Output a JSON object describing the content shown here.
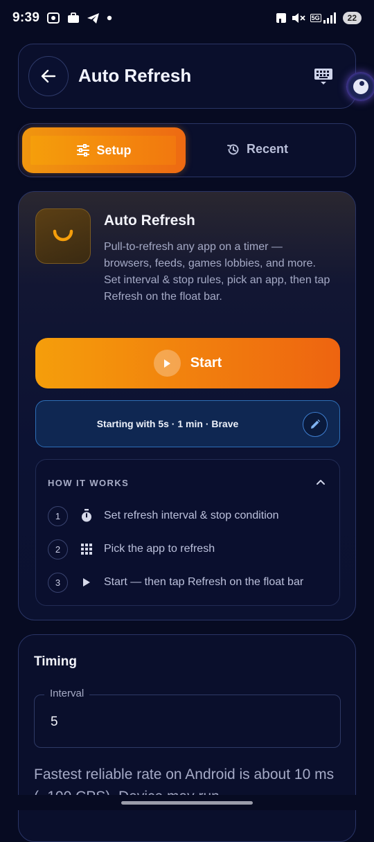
{
  "status_bar": {
    "time": "9:39",
    "signal_label": "5G",
    "battery": "22"
  },
  "header": {
    "title": "Auto Refresh"
  },
  "tabs": {
    "setup_label": "Setup",
    "recent_label": "Recent"
  },
  "main_card": {
    "title": "Auto Refresh",
    "description": "Pull-to-refresh any app on a timer — browsers, feeds, games lobbies, and more. Set interval & stop rules, pick an app, then tap Refresh on the float bar.",
    "start_label": "Start",
    "summary": "Starting with 5s · 1 min · Brave"
  },
  "how_it_works": {
    "title": "HOW IT WORKS",
    "steps": [
      {
        "num": "1",
        "icon": "timer-icon",
        "text": "Set refresh interval & stop condition"
      },
      {
        "num": "2",
        "icon": "grid-icon",
        "text": "Pick the app to refresh"
      },
      {
        "num": "3",
        "icon": "play-icon",
        "text": "Start — then tap Refresh on the float bar"
      }
    ]
  },
  "timing": {
    "title": "Timing",
    "interval_label": "Interval",
    "interval_value": "5",
    "note": "Fastest reliable rate on Android is about 10 ms (~100 CPS). Device may run"
  },
  "colors": {
    "background": "#070b22",
    "accent_start": "#f59e0b",
    "accent_end": "#ee6410",
    "summary_border": "#2e6fb8"
  }
}
